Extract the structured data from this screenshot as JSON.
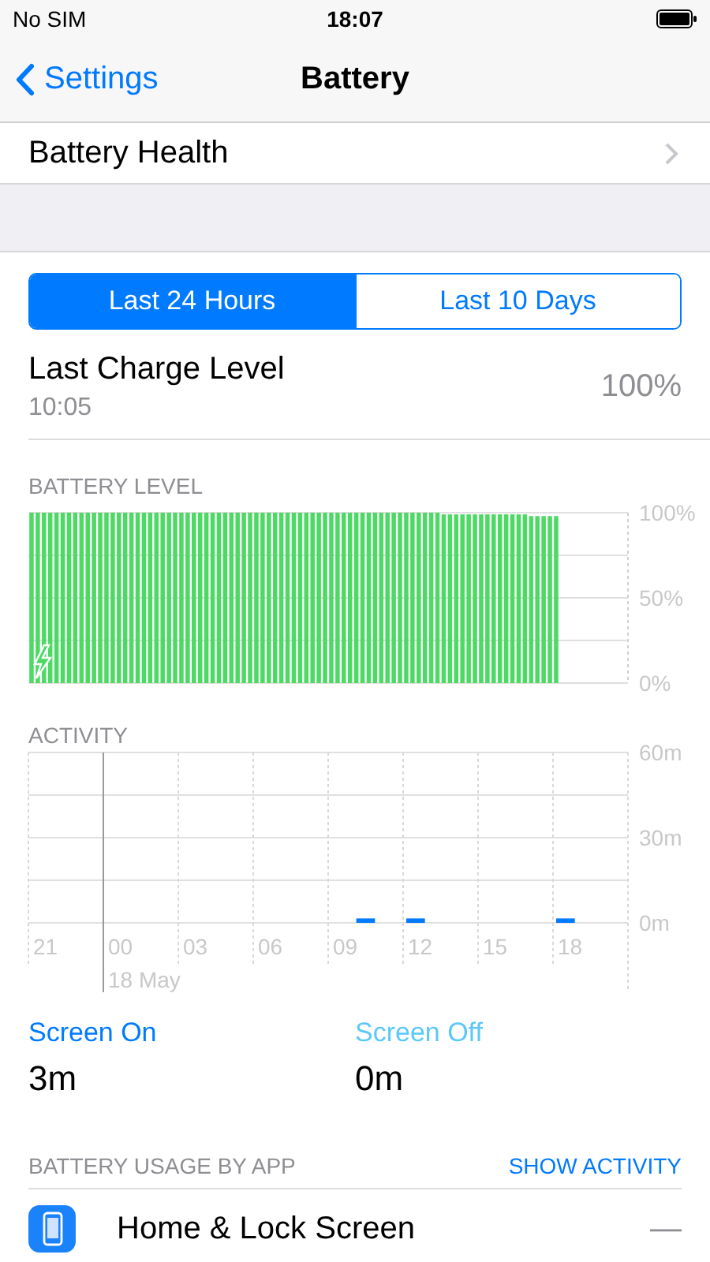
{
  "status_bar": {
    "carrier": "No SIM",
    "time": "18:07"
  },
  "nav": {
    "back": "Settings",
    "title": "Battery"
  },
  "battery_health": {
    "label": "Battery Health"
  },
  "segments": [
    {
      "label": "Last 24 Hours",
      "selected": true
    },
    {
      "label": "Last 10 Days",
      "selected": false
    }
  ],
  "last_charge": {
    "title": "Last Charge Level",
    "time": "10:05",
    "value": "100%"
  },
  "battery_chart": {
    "title": "BATTERY LEVEL",
    "chart_data": {
      "type": "bar",
      "values": [
        100,
        100,
        100,
        100,
        100,
        100,
        100,
        100,
        100,
        100,
        100,
        100,
        100,
        100,
        100,
        100,
        100,
        100,
        100,
        100,
        100,
        100,
        100,
        100,
        100,
        100,
        100,
        100,
        100,
        100,
        100,
        100,
        100,
        100,
        100,
        100,
        100,
        100,
        100,
        100,
        100,
        100,
        100,
        100,
        100,
        100,
        100,
        100,
        100,
        100,
        100,
        100,
        100,
        100,
        100,
        100,
        100,
        100,
        100,
        100,
        100,
        100,
        100,
        100,
        100,
        100,
        99,
        99,
        99,
        99,
        99,
        99,
        99,
        99,
        99,
        99,
        99,
        99,
        99,
        99,
        98,
        98,
        98,
        98,
        98,
        null,
        null,
        null,
        null,
        null,
        null,
        null,
        null,
        null,
        null,
        null
      ],
      "ylim": [
        0,
        100
      ],
      "yticks": [
        {
          "value": 0,
          "label": "0%"
        },
        {
          "value": 50,
          "label": "50%"
        },
        {
          "value": 100,
          "label": "100%"
        }
      ]
    }
  },
  "activity_chart": {
    "title": "ACTIVITY",
    "date_label": "18 May",
    "chart_data": {
      "type": "bar",
      "categories": [
        "21",
        null,
        null,
        "00",
        null,
        null,
        "03",
        null,
        null,
        "06",
        null,
        null,
        "09",
        null,
        null,
        "12",
        null,
        null,
        "15",
        null,
        null,
        "18",
        null,
        null
      ],
      "values": [
        0,
        0,
        0,
        0,
        0,
        0,
        0,
        0,
        0,
        0,
        0,
        0,
        0,
        1,
        0,
        1,
        0,
        0,
        0,
        0,
        0,
        1,
        0,
        0
      ],
      "ylim": [
        0,
        60
      ],
      "yticks": [
        {
          "value": 0,
          "label": "0m"
        },
        {
          "value": 30,
          "label": "30m"
        },
        {
          "value": 60,
          "label": "60m"
        }
      ]
    }
  },
  "screen": [
    {
      "kind": "on",
      "label": "Screen On",
      "value": "3m"
    },
    {
      "kind": "off",
      "label": "Screen Off",
      "value": "0m"
    }
  ],
  "usage": {
    "title": "BATTERY USAGE BY APP",
    "action": "SHOW ACTIVITY"
  },
  "apps": [
    {
      "name": "Home & Lock Screen",
      "value": "—"
    }
  ]
}
